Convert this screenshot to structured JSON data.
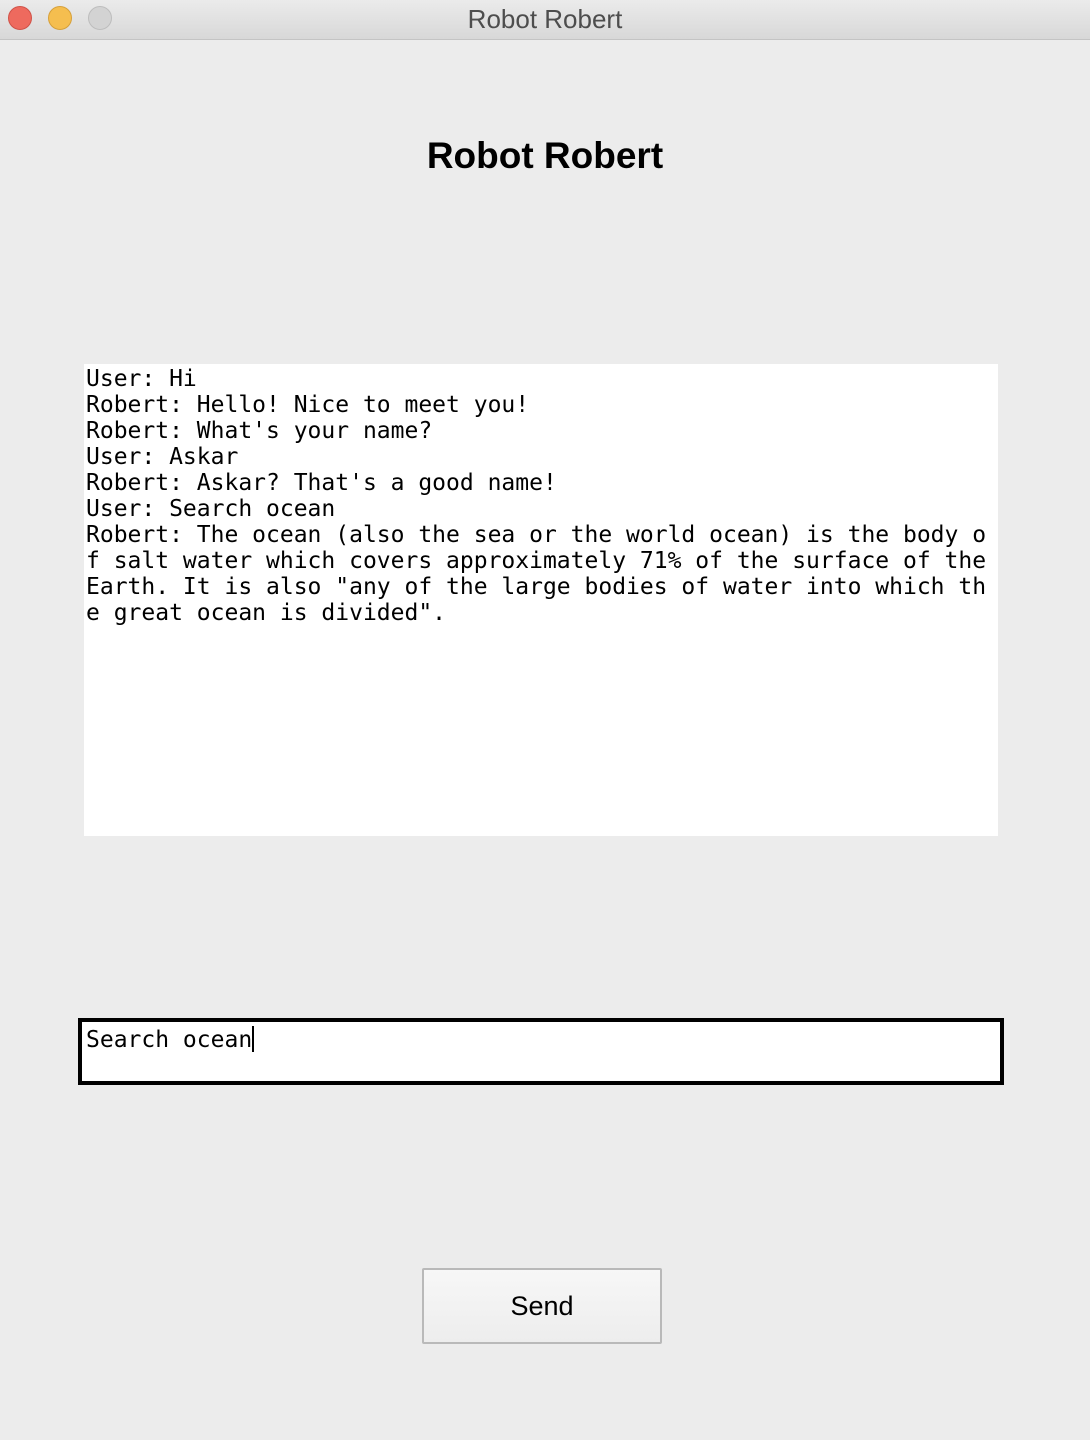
{
  "window": {
    "title": "Robot Robert"
  },
  "heading": "Robot Robert",
  "chat_log": {
    "lines": [
      "User: Hi",
      "Robert: Hello! Nice to meet you!",
      "Robert: What's your name?",
      "User: Askar",
      "Robert: Askar? That's a good name!",
      "User: Search ocean",
      "Robert: The ocean (also the sea or the world ocean) is the body of salt water which covers approximately 71% of the surface of the Earth. It is also \"any of the large bodies of water into which the great ocean is divided\"."
    ]
  },
  "input": {
    "value": "Search ocean"
  },
  "send_button": {
    "label": "Send"
  },
  "colors": {
    "window_bg": "#ececec",
    "close": "#ee6a5e",
    "minimize": "#f5be4f",
    "zoom_disabled": "#d3d3d3"
  }
}
